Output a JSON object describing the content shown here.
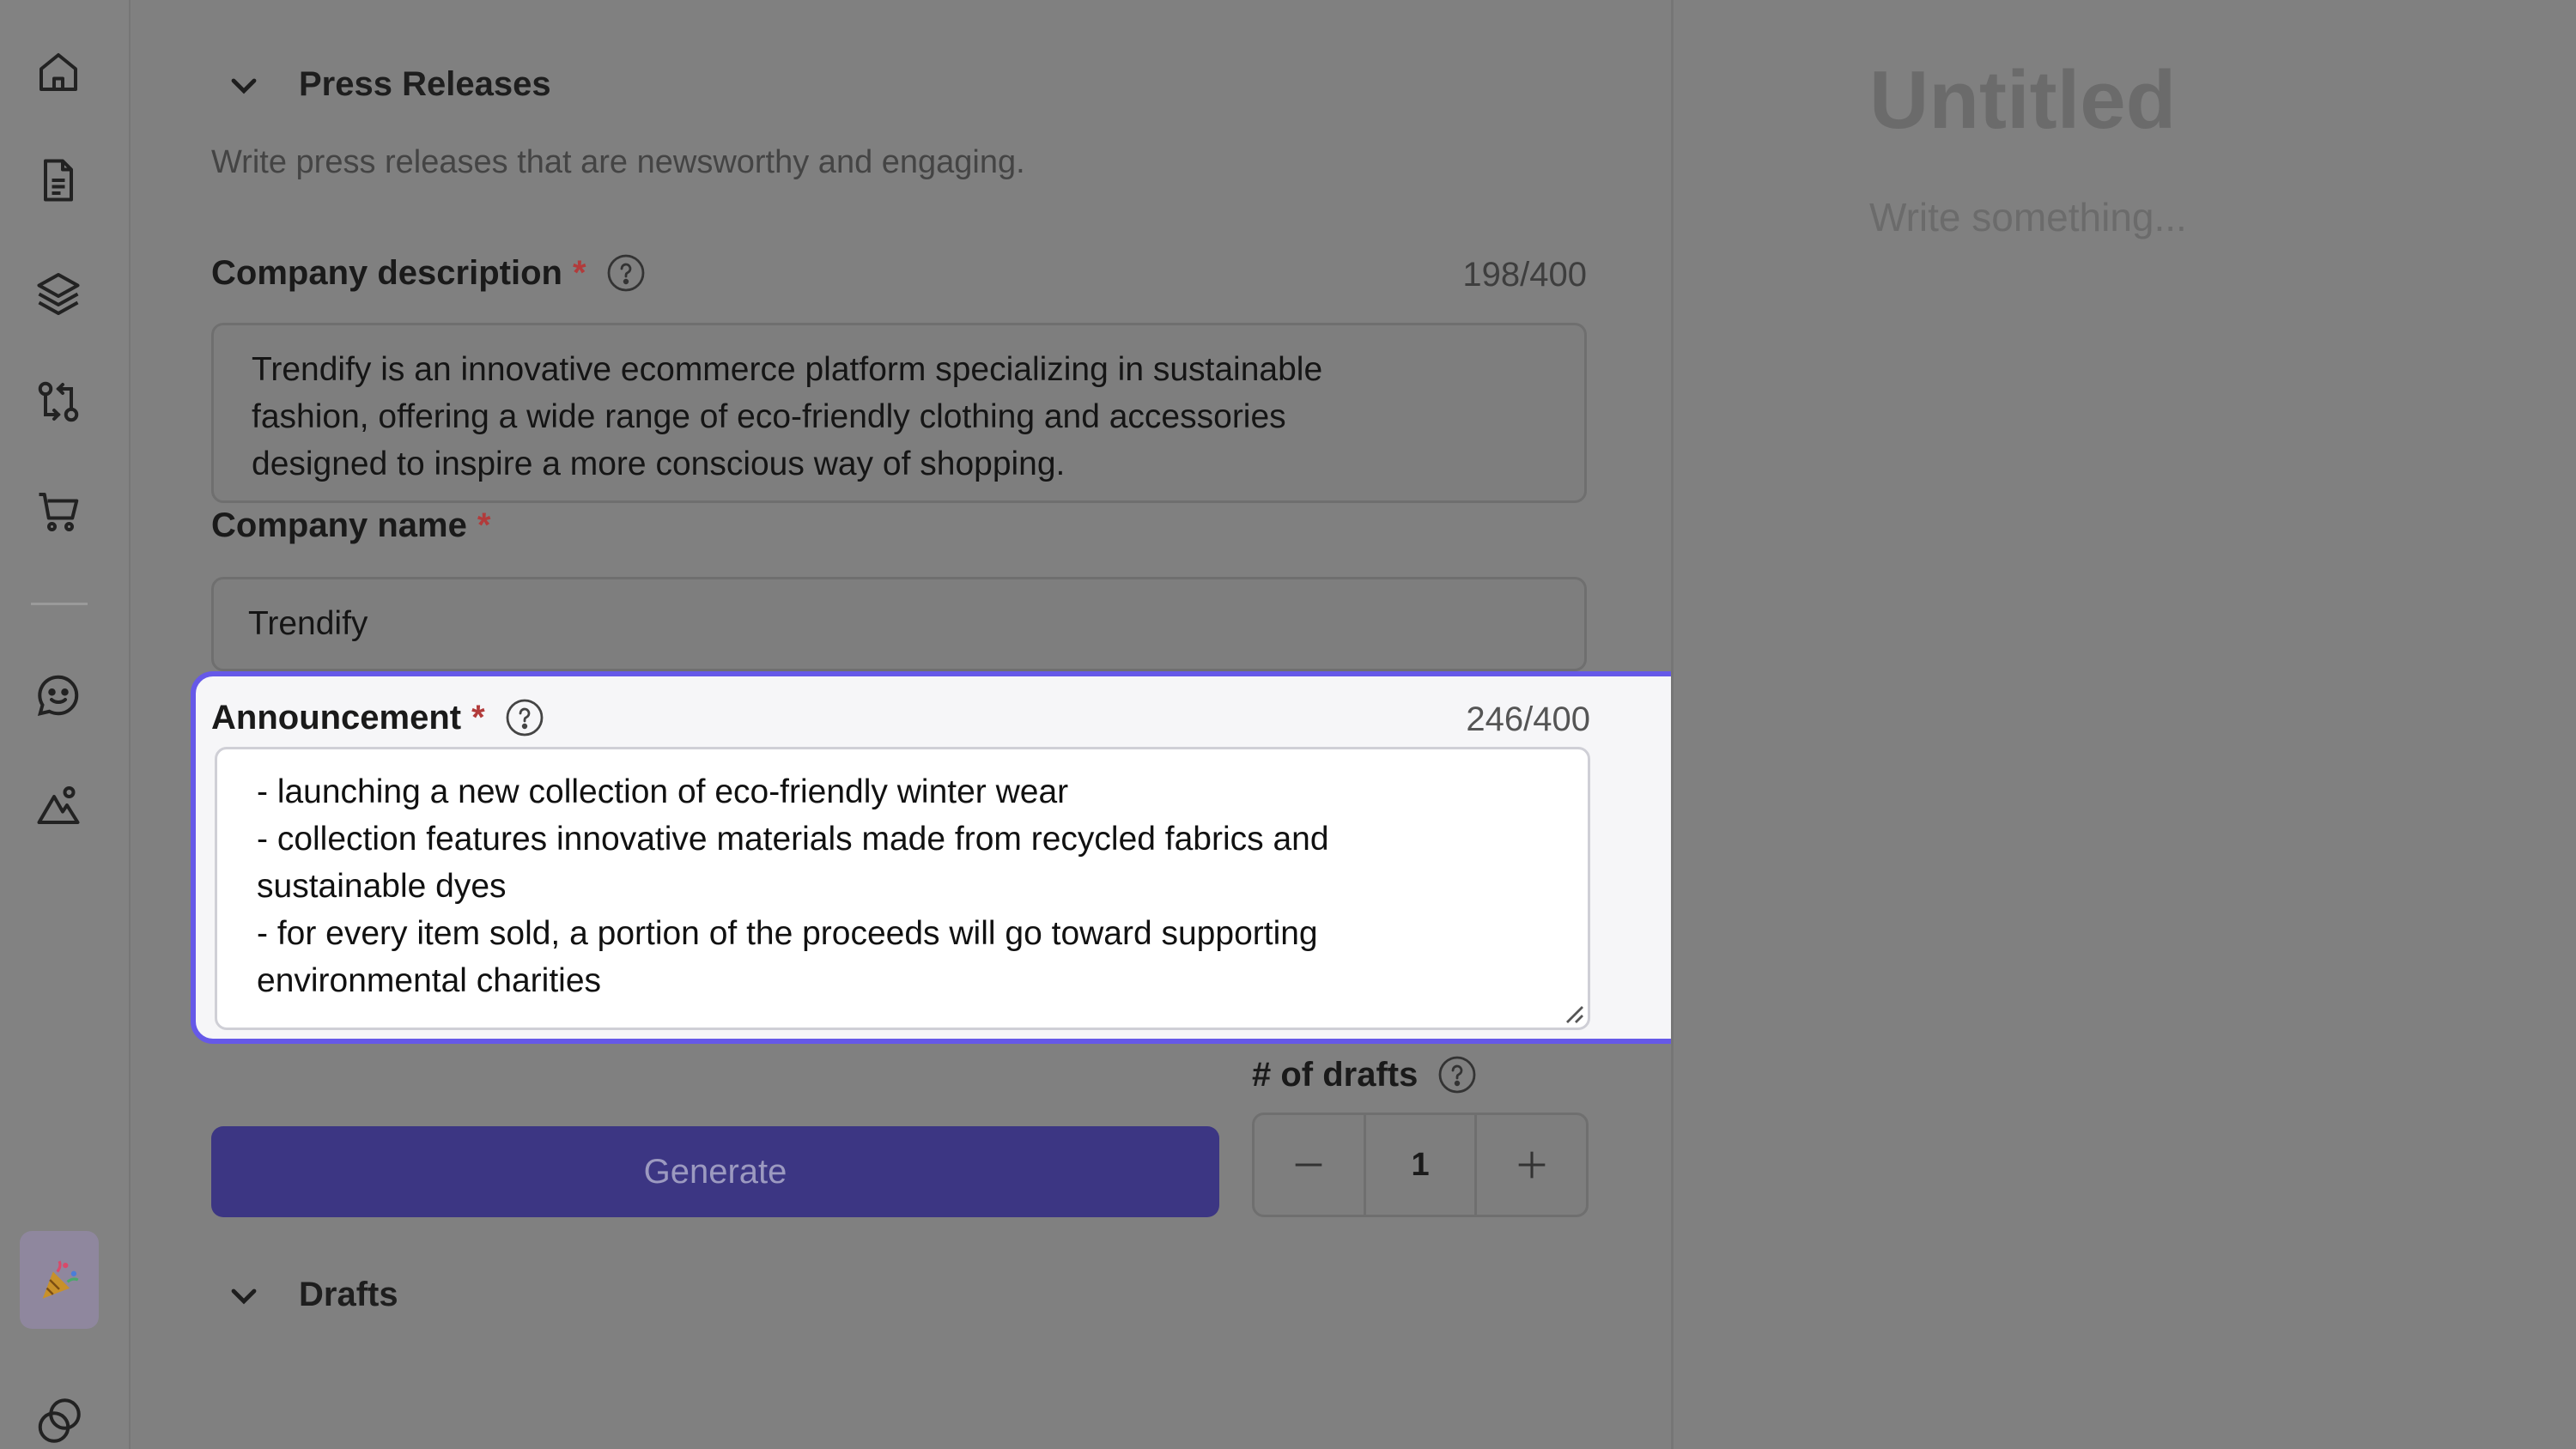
{
  "sidebar": {
    "items": [
      {
        "name": "home-icon"
      },
      {
        "name": "document-icon"
      },
      {
        "name": "layers-icon"
      },
      {
        "name": "git-compare-icon"
      },
      {
        "name": "cart-icon"
      },
      {
        "name": "chat-smile-icon"
      },
      {
        "name": "landscape-icon"
      }
    ],
    "promo_icon": "party-popper-icon",
    "bottom_icon": "circles-icon"
  },
  "form": {
    "section_title": "Press Releases",
    "subtitle": "Write press releases that are newsworthy and engaging.",
    "company_description": {
      "label": "Company description",
      "required_mark": "*",
      "counter": "198/400",
      "value": "Trendify is an innovative ecommerce platform specializing in sustainable\nfashion, offering a wide range of eco-friendly clothing and accessories\ndesigned to inspire a more conscious way of shopping."
    },
    "company_name": {
      "label": "Company name",
      "required_mark": "*",
      "value": "Trendify"
    },
    "announcement": {
      "label": "Announcement",
      "required_mark": "*",
      "counter": "246/400",
      "value": "- launching a new collection of eco-friendly winter wear\n- collection features innovative materials made from recycled fabrics and\nsustainable dyes\n- for every item sold, a portion of the proceeds will go toward supporting\nenvironmental charities"
    },
    "drafts_count": {
      "label": "# of drafts",
      "value": "1"
    },
    "generate_label": "Generate",
    "drafts_section_title": "Drafts"
  },
  "editor": {
    "title_placeholder": "Untitled",
    "body_placeholder": "Write something..."
  },
  "colors": {
    "accent": "#6659e8",
    "button": "#3c3683",
    "required": "#b23b3b"
  }
}
